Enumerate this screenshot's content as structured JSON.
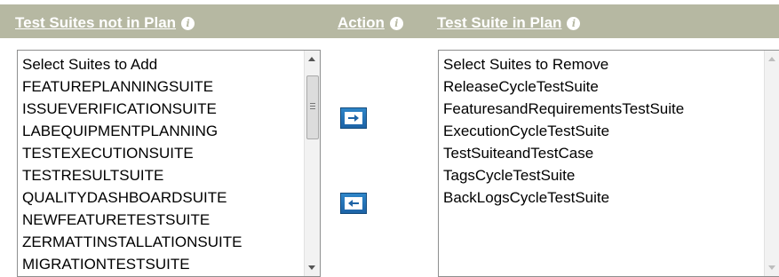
{
  "header": {
    "not_in_plan_label": "Test Suites not in Plan",
    "action_label": "Action",
    "in_plan_label": "Test Suite in Plan",
    "info_glyph": "i"
  },
  "left_list": {
    "items": [
      "Select Suites to Add",
      "FEATUREPLANNINGSUITE",
      "ISSUEVERIFICATIONSUITE",
      "LABEQUIPMENTPLANNING",
      "TESTEXECUTIONSUITE",
      "TESTRESULTSUITE",
      "QUALITYDASHBOARDSUITE",
      "NEWFEATURETESTSUITE",
      "ZERMATTINSTALLATIONSUITE",
      "MIGRATIONTESTSUITE"
    ]
  },
  "right_list": {
    "items": [
      "Select Suites to Remove",
      "ReleaseCycleTestSuite",
      "FeaturesandRequirementsTestSuite",
      "ExecutionCycleTestSuite",
      "TestSuiteandTestCase",
      "TagsCycleTestSuite",
      "BackLogsCycleTestSuite"
    ]
  },
  "actions": {
    "add_icon": "arrow-right-icon",
    "remove_icon": "arrow-left-icon"
  },
  "colors": {
    "header_bg": "#b6b8a2",
    "button_blue": "#1d63a6"
  }
}
